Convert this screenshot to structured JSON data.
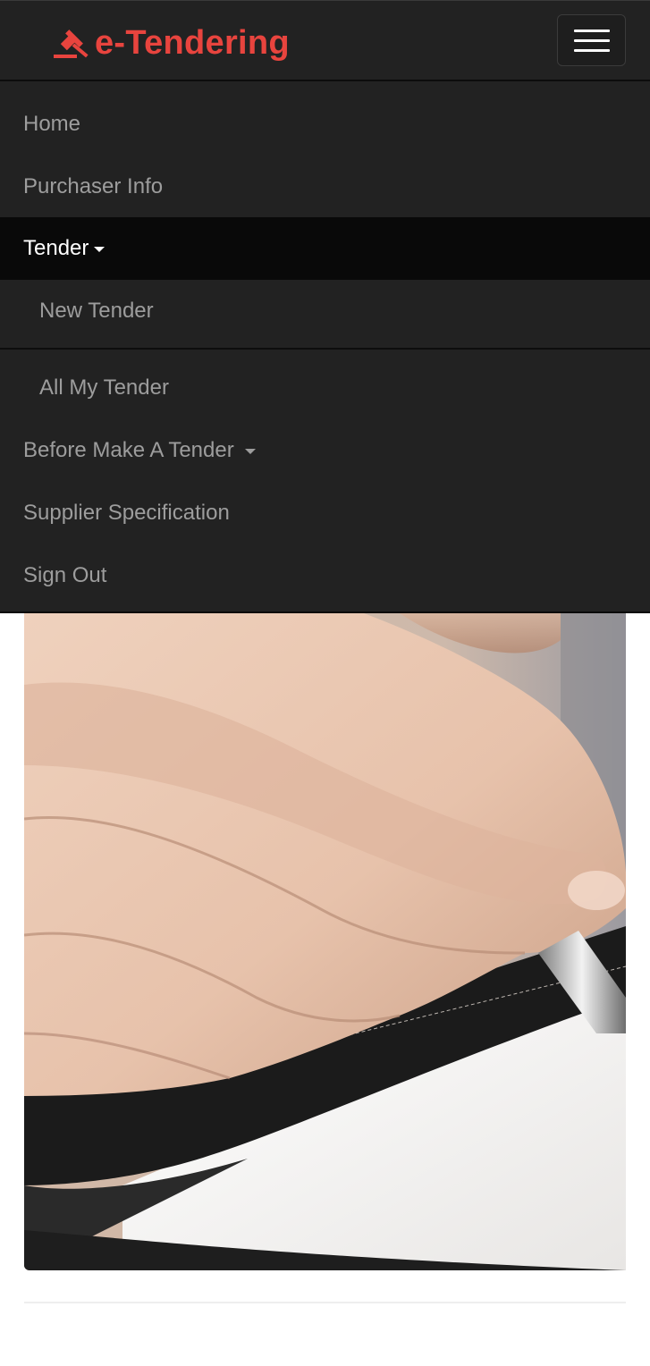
{
  "brand": {
    "name": "e-Tendering",
    "icon": "gavel-icon",
    "color": "#e8443e"
  },
  "navbar": {
    "toggle_icon": "hamburger-menu-icon"
  },
  "menu": {
    "home": "Home",
    "purchaser_info": "Purchaser Info",
    "tender": "Tender",
    "new_tender": "New Tender",
    "all_my_tender": "All My Tender",
    "before_make_a_tender": "Before Make A Tender",
    "supplier_specification": "Supplier Specification",
    "sign_out": "Sign Out"
  },
  "hero": {
    "image": "hand-signing-document-photo"
  }
}
